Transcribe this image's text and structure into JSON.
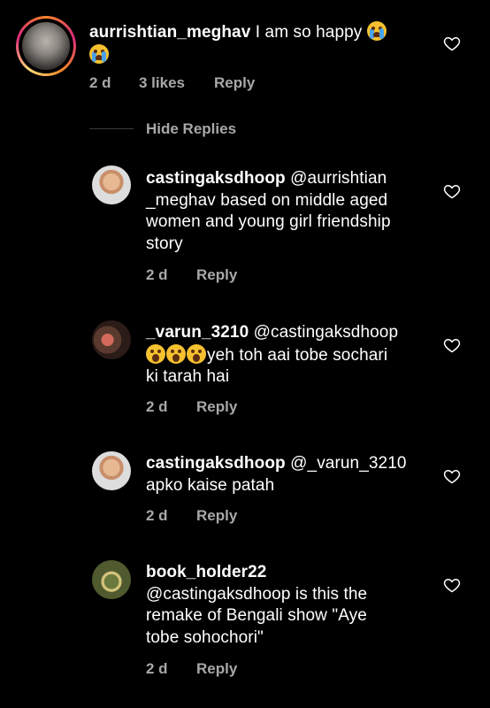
{
  "comments": [
    {
      "username": "aurrishtian_meghav",
      "text": "I am so happy",
      "time": "2 d",
      "likes": "3 likes",
      "reply": "Reply"
    }
  ],
  "hide_replies": "Hide Replies",
  "replies": [
    {
      "username": "castingaksdhoop",
      "line1": "@aurrishtian",
      "line2": "_meghav based on middle aged",
      "line3": "women and young girl friendship",
      "line4": "story",
      "time": "2 d",
      "reply": "Reply"
    },
    {
      "username": "_varun_3210",
      "line1": "@castingaksdhoop",
      "line2": "yeh toh aai tobe sochari",
      "line3": "ki tarah hai",
      "time": "2 d",
      "reply": "Reply"
    },
    {
      "username": "castingaksdhoop",
      "line1": "@_varun_3210",
      "line2": "apko kaise patah",
      "time": "2 d",
      "reply": "Reply"
    },
    {
      "username": "book_holder22",
      "line1": "@castingaksdhoop is this the",
      "line2": "remake of Bengali show \"Aye",
      "line3": "tobe sohochori\"",
      "time": "2 d",
      "reply": "Reply"
    }
  ],
  "icons": {
    "like": "heart-outline-icon",
    "emoji_cry": "loudly-crying-face",
    "emoji_shock": "astonished-face"
  },
  "colors": {
    "background": "#000000",
    "text": "#ffffff",
    "meta": "#a8a8a8"
  }
}
